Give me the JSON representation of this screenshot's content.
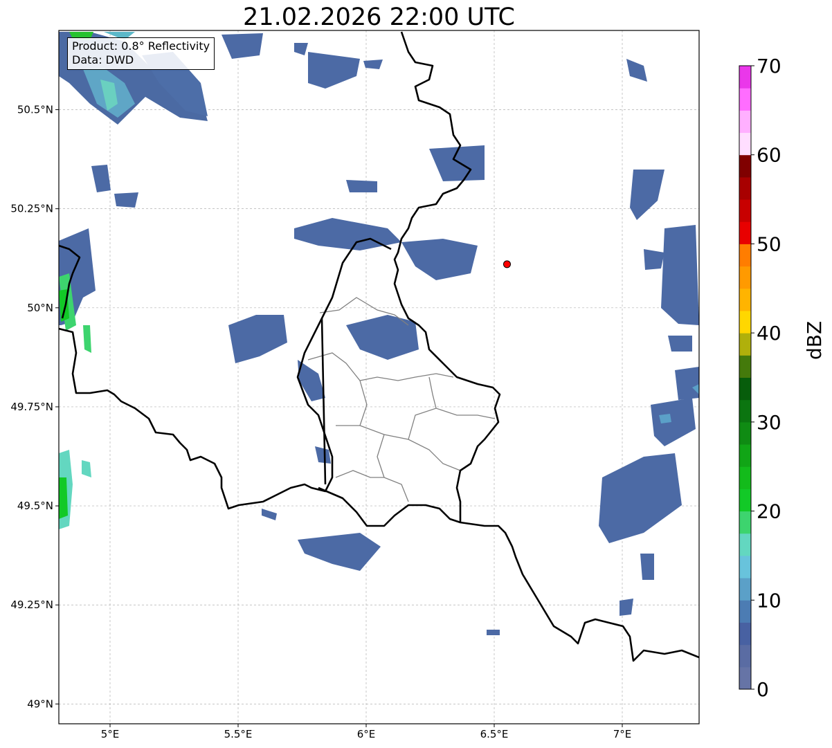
{
  "title": "21.02.2026 22:00 UTC",
  "info": {
    "product": "Product: 0.8° Reflectivity",
    "source": "Data: DWD"
  },
  "map": {
    "lon_range": [
      4.8,
      7.3
    ],
    "lat_range": [
      48.95,
      50.7
    ],
    "grid": true,
    "lon_ticks": [
      {
        "v": 5.0,
        "label": "5°E"
      },
      {
        "v": 5.5,
        "label": "5.5°E"
      },
      {
        "v": 6.0,
        "label": "6°E"
      },
      {
        "v": 6.5,
        "label": "6.5°E"
      },
      {
        "v": 7.0,
        "label": "7°E"
      }
    ],
    "lat_ticks": [
      {
        "v": 49.0,
        "label": "49°N"
      },
      {
        "v": 49.25,
        "label": "49.25°N"
      },
      {
        "v": 49.5,
        "label": "49.5°N"
      },
      {
        "v": 49.75,
        "label": "49.75°N"
      },
      {
        "v": 50.0,
        "label": "50°N"
      },
      {
        "v": 50.25,
        "label": "50.25°N"
      },
      {
        "v": 50.5,
        "label": "50.5°N"
      }
    ],
    "radar_site": {
      "lon": 6.55,
      "lat": 50.11,
      "color": "#ff0000"
    },
    "borders": {
      "country_color": "#000000",
      "district_color": "#808080"
    }
  },
  "colorbar": {
    "label": "dBZ",
    "min": 0,
    "max": 70,
    "tick_labels": [
      "0",
      "10",
      "20",
      "30",
      "40",
      "50",
      "60",
      "70"
    ],
    "colors": [
      "#6674a6",
      "#5a6ca3",
      "#4861a2",
      "#4c7cb3",
      "#5ba0c8",
      "#68c3dc",
      "#63d7c0",
      "#3dd46e",
      "#12c927",
      "#13bb1b",
      "#11a516",
      "#0f8b13",
      "#0b7510",
      "#075d0b",
      "#447a0b",
      "#b0b00b",
      "#ffd700",
      "#ffb400",
      "#ff9a00",
      "#ff7d00",
      "#e80000",
      "#c80000",
      "#a80000",
      "#800000",
      "#ffdeff",
      "#ffb0ff",
      "#ff6dff",
      "#ea37ea"
    ]
  }
}
